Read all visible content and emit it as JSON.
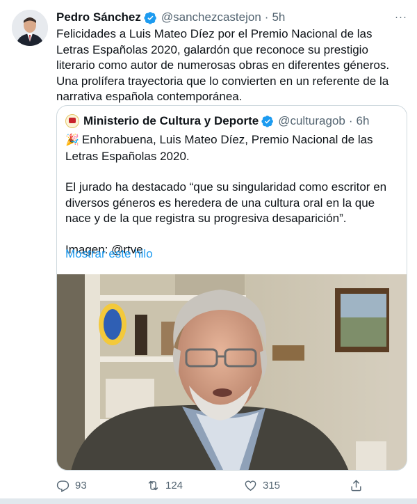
{
  "tweet": {
    "author_name": "Pedro Sánchez",
    "author_handle": "@sanchezcastejon",
    "separator": "·",
    "time": "5h",
    "more_icon": "···",
    "text": "Felicidades a Luis Mateo Díez por el Premio Nacional de las Letras Españolas 2020, galardón que reconoce su prestigio literario como autor de numerosas obras en diferentes géneros. Una prolífera trayectoria que lo convierten en un referente de la narrativa española contemporánea."
  },
  "quoted": {
    "author_name": "Ministerio de Cultura y Deporte",
    "author_handle": "@culturagob",
    "separator": "·",
    "time": "6h",
    "emoji": "🎉",
    "paragraph1": "Enhorabuena, Luis Mateo Díez, Premio Nacional de las Letras Españolas 2020.",
    "paragraph2": "El jurado ha destacado “que su singularidad como escritor en diversos géneros es heredera de una cultura oral en la que nace y de la que registra su progresiva desaparición”.",
    "paragraph3": "Imagen: @rtve",
    "show_thread": "Mostrar este hilo"
  },
  "actions": {
    "replies": "93",
    "retweets": "124",
    "likes": "315"
  },
  "icons": {
    "verified": "verified-badge-icon",
    "reply": "reply-icon",
    "retweet": "retweet-icon",
    "like": "heart-icon",
    "share": "share-icon"
  },
  "colors": {
    "accent": "#1d9bf0",
    "secondary_text": "#536471",
    "border": "#cfd9de"
  }
}
